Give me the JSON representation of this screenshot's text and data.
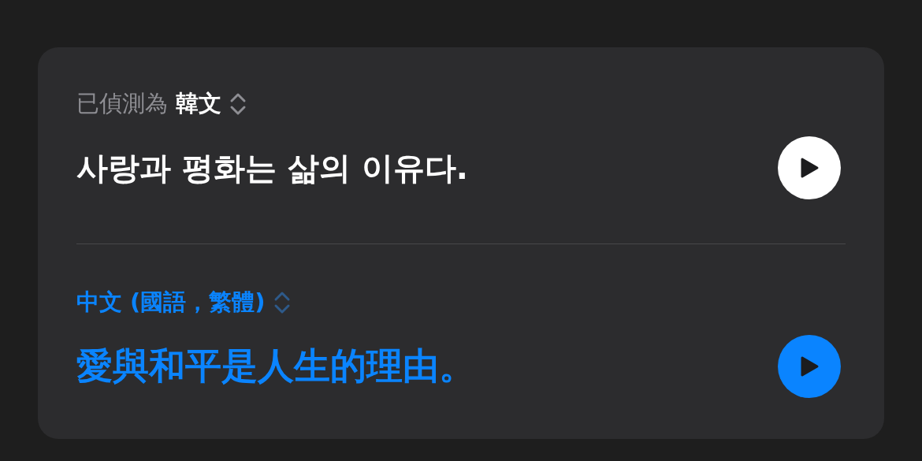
{
  "sections": [
    {
      "kind": "source",
      "label": "已偵測為",
      "language": "韓文",
      "text": "사랑과 평화는 삶의 이유다."
    },
    {
      "kind": "target",
      "language": "中文 (國語，繁體)",
      "text": "愛與和平是人生的理由。"
    }
  ]
}
